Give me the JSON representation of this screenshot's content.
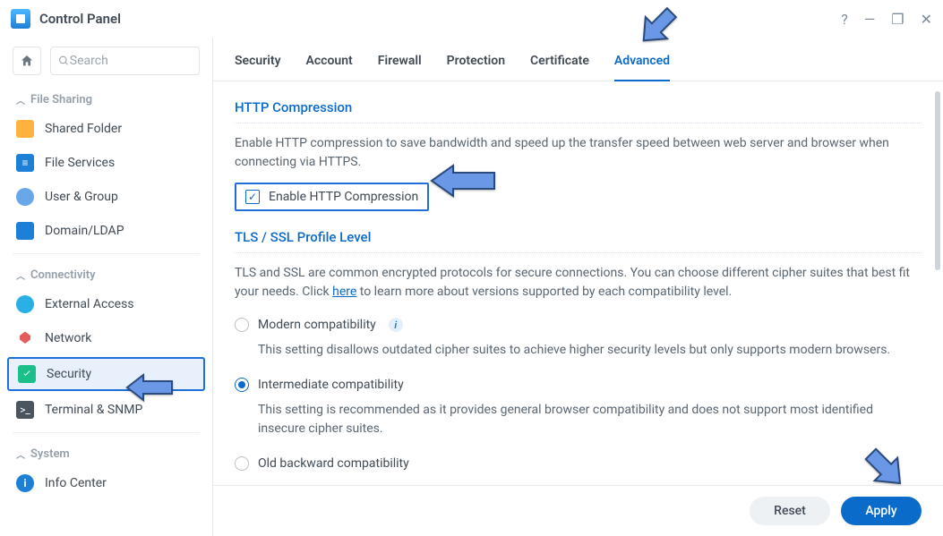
{
  "window": {
    "title": "Control Panel"
  },
  "search": {
    "placeholder": "Search"
  },
  "sidebar": {
    "groups": [
      {
        "label": "File Sharing"
      },
      {
        "label": "Connectivity"
      },
      {
        "label": "System"
      }
    ],
    "items": [
      {
        "label": "Shared Folder"
      },
      {
        "label": "File Services"
      },
      {
        "label": "User & Group"
      },
      {
        "label": "Domain/LDAP"
      },
      {
        "label": "External Access"
      },
      {
        "label": "Network"
      },
      {
        "label": "Security"
      },
      {
        "label": "Terminal & SNMP"
      },
      {
        "label": "Info Center"
      }
    ]
  },
  "tabs": [
    {
      "label": "Security"
    },
    {
      "label": "Account"
    },
    {
      "label": "Firewall"
    },
    {
      "label": "Protection"
    },
    {
      "label": "Certificate"
    },
    {
      "label": "Advanced"
    }
  ],
  "http_compression": {
    "title": "HTTP Compression",
    "desc": "Enable HTTP compression to save bandwidth and speed up the transfer speed between web server and browser when connecting via HTTPS.",
    "checkbox_label": "Enable HTTP Compression"
  },
  "tls": {
    "title": "TLS / SSL Profile Level",
    "desc_pre": "TLS and SSL are common encrypted protocols for secure connections. You can choose different cipher suites that best fit your needs. Click ",
    "here": "here",
    "desc_post": " to learn more about versions supported by each compatibility level.",
    "options": [
      {
        "label": "Modern compatibility",
        "sub": "This setting disallows outdated cipher suites to achieve higher security levels but only supports modern browsers."
      },
      {
        "label": "Intermediate compatibility",
        "sub": "This setting is recommended as it provides general browser compatibility and does not support most identified insecure cipher suites."
      },
      {
        "label": "Old backward compatibility"
      }
    ]
  },
  "footer": {
    "reset": "Reset",
    "apply": "Apply"
  }
}
